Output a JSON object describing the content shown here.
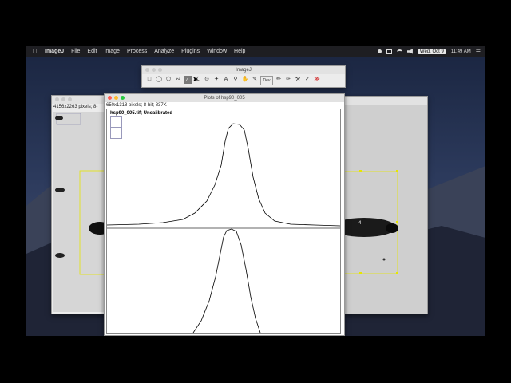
{
  "menubar": {
    "app_name": "ImageJ",
    "items": [
      "File",
      "Edit",
      "Image",
      "Process",
      "Analyze",
      "Plugins",
      "Window",
      "Help"
    ],
    "date": "Wed, Oct 9",
    "time": "11:49 AM"
  },
  "toolbar": {
    "title": "ImageJ",
    "tools": [
      "rectangle",
      "oval",
      "polygon",
      "freehand",
      "line",
      "angle",
      "point",
      "wand",
      "text",
      "magnifier",
      "hand",
      "color-picker",
      "dev",
      "pencil",
      "brush",
      "flood-fill",
      "dropper",
      "more"
    ],
    "dev_label": "Dev",
    "more_label": "≫"
  },
  "image_window": {
    "info": "4156x2263 pixels; 8-"
  },
  "plot_window": {
    "title": "Plots of hsp90_005",
    "info": "650x1318 pixels; 8-bit; 837K",
    "plot_label": "hsp90_005.tif; Uncalibrated"
  },
  "right_window": {
    "lane_label": "4"
  },
  "colors": {
    "close": "#ff5f57",
    "minimize": "#febc2e",
    "zoom": "#28c840",
    "selection": "#e6e600"
  }
}
